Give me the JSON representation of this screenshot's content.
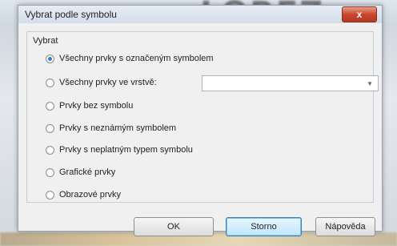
{
  "window": {
    "title": "Vybrat podle symbolu",
    "close_symbol": "x"
  },
  "group": {
    "label": "Vybrat"
  },
  "options": [
    {
      "label": "Všechny prvky s označeným symbolem",
      "checked": true
    },
    {
      "label": "Všechny prvky ve vrstvě:",
      "checked": false
    },
    {
      "label": "Prvky bez symbolu",
      "checked": false
    },
    {
      "label": "Prvky s neznámým symbolem",
      "checked": false
    },
    {
      "label": "Prvky s neplatným typem symbolu",
      "checked": false
    },
    {
      "label": "Grafické prvky",
      "checked": false
    },
    {
      "label": "Obrazové prvky",
      "checked": false
    }
  ],
  "layer_select": {
    "value": ""
  },
  "buttons": {
    "ok": "OK",
    "cancel": "Storno",
    "help": "Nápověda"
  },
  "colors": {
    "accent": "#2e7fd0",
    "close": "#c9462e"
  }
}
